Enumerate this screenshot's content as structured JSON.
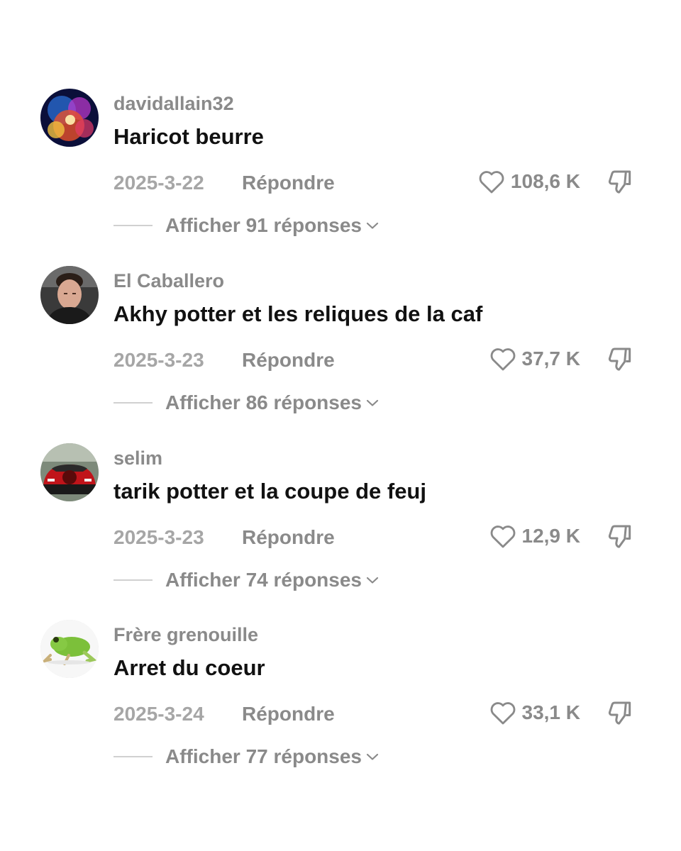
{
  "comments": [
    {
      "username": "davidallain32",
      "text": "Haricot beurre",
      "date": "2025-3-22",
      "reply_label": "Répondre",
      "likes": "108,6 K",
      "view_replies": "Afficher 91 réponses",
      "avatar_icon": "fireworks-avatar"
    },
    {
      "username": "El Caballero",
      "text": "Akhy potter et les reliques de la caf",
      "date": "2025-3-23",
      "reply_label": "Répondre",
      "likes": "37,7 K",
      "view_replies": "Afficher 86 réponses",
      "avatar_icon": "man-portrait-avatar"
    },
    {
      "username": "selim",
      "text": "tarik potter et la coupe de feuj",
      "date": "2025-3-23",
      "reply_label": "Répondre",
      "likes": "12,9 K",
      "view_replies": "Afficher 74 réponses",
      "avatar_icon": "red-car-avatar"
    },
    {
      "username": "Frère grenouille",
      "text": "Arret du coeur",
      "date": "2025-3-24",
      "reply_label": "Répondre",
      "likes": "33,1 K",
      "view_replies": "Afficher 77 réponses",
      "avatar_icon": "frog-avatar"
    }
  ],
  "icons": {
    "like": "heart-outline-icon",
    "dislike": "thumbs-down-icon",
    "expand": "chevron-down-icon"
  },
  "colors": {
    "username": "#8a8a8a",
    "text": "#111111",
    "date": "#a6a6a6",
    "meta": "#8a8a8a",
    "background": "#ffffff"
  }
}
